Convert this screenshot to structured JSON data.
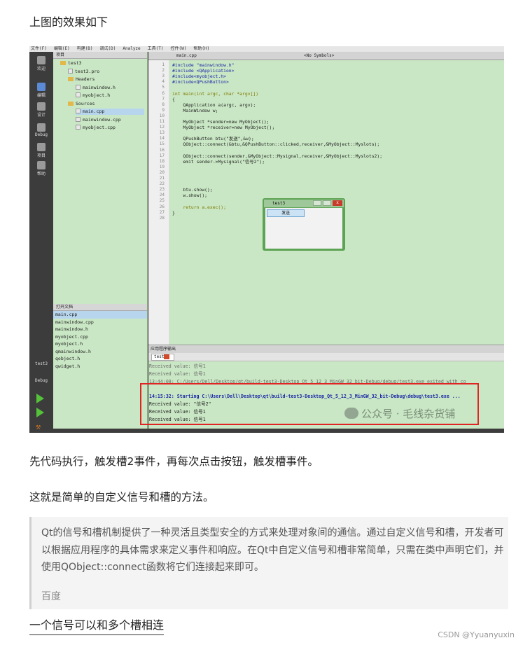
{
  "heading_top": "上图的效果如下",
  "screenshot": {
    "menubar": [
      "文件(F)",
      "编辑(E)",
      "构建(B)",
      "调试(D)",
      "Analyze",
      "工具(T)",
      "控件(W)",
      "帮助(H)"
    ],
    "project_panel_title": "项目",
    "tree": [
      {
        "label": "test3",
        "kind": "folder",
        "indent": 0
      },
      {
        "label": "test3.pro",
        "kind": "file",
        "indent": 1
      },
      {
        "label": "Headers",
        "kind": "folder",
        "indent": 1
      },
      {
        "label": "mainwindow.h",
        "kind": "file",
        "indent": 2
      },
      {
        "label": "myobject.h",
        "kind": "file",
        "indent": 2
      },
      {
        "label": "Sources",
        "kind": "folder",
        "indent": 1
      },
      {
        "label": "main.cpp",
        "kind": "file",
        "indent": 2,
        "selected": true
      },
      {
        "label": "mainwindow.cpp",
        "kind": "file",
        "indent": 2
      },
      {
        "label": "myobject.cpp",
        "kind": "file",
        "indent": 2
      }
    ],
    "modes": [
      "欢迎",
      "编辑",
      "设计",
      "Debug",
      "项目",
      "帮助"
    ],
    "mode_bottom": [
      "test3",
      "Debug"
    ],
    "open_docs_title": "打开文档",
    "open_docs": [
      "main.cpp",
      "mainwindow.cpp",
      "mainwindow.h",
      "myobject.cpp",
      "myobject.h",
      "qmainwindow.h",
      "qobject.h",
      "qwidget.h"
    ],
    "editor_file": "main.cpp",
    "editor_symbols": "<No Symbols>",
    "code_lines": [
      "#include \"mainwindow.h\"",
      "#include <QApplication>",
      "#include<myobject.h>",
      "#include<QPushButton>",
      "",
      "int main(int argc, char *argv[])",
      "{",
      "    QApplication a(argc, argv);",
      "    MainWindow w;",
      "",
      "    MyObject *sender=new MyObject();",
      "    MyObject *receiver=new MyObject();",
      "",
      "    QPushButton btu(\"发送\",&w);",
      "    QObject::connect(&btu,&QPushButton::clicked,receiver,&MyObject::Myslots);",
      "",
      "    QObject::connect(sender,&MyObject::Mysignal,receiver,&MyObject::Myslots2);",
      "    emit sender->Mysignal(\"信号2\");",
      "",
      "",
      "",
      "",
      "    btu.show();",
      "    w.show();",
      "",
      "    return a.exec();",
      "}",
      ""
    ],
    "dialog": {
      "title": "test3",
      "button": "发送",
      "close": "x"
    },
    "output_title": "应用程序输出",
    "output_tab": "test3",
    "output_lines": [
      {
        "text": "Received value: 信号1",
        "style": "gray"
      },
      {
        "text": "Received value: 信号1",
        "style": "gray"
      },
      {
        "text": "13:44:08: C:/Users/Dell/Desktop/qt/build-test3-Desktop_Qt_5_12_3_MinGW_32_bit-Debug/debug/test3.exe exited with co",
        "style": "gray"
      },
      {
        "text": "",
        "style": "gray"
      },
      {
        "text": "14:15:32: Starting C:\\Users\\Dell\\Desktop\\qt\\build-test3-Desktop_Qt_5_12_3_MinGW_32_bit-Debug\\debug\\test3.exe ...",
        "style": "blue"
      },
      {
        "text": "Received value: \"信号2\"",
        "style": "normal"
      },
      {
        "text": "Received value: 信号1",
        "style": "normal"
      },
      {
        "text": "Received value: 信号1",
        "style": "normal"
      }
    ],
    "watermark": "公众号 · 毛线杂货铺"
  },
  "para1": "先代码执行，触发槽2事件，再每次点击按钮，触发槽事件。",
  "para2": "这就是简单的自定义信号和槽的方法。",
  "quote": {
    "text": "Qt的信号和槽机制提供了一种灵活且类型安全的方式来处理对象间的通信。通过自定义信号和槽，开发者可以根据应用程序的具体需求来定义事件和响应。在Qt中自定义信号和槽非常简单，只需在类中声明它们，并使用QObject::connect函数将它们连接起来即可。",
    "source": "百度"
  },
  "heading_bottom": "一个信号可以和多个槽相连",
  "csdn_mark": "CSDN @Yyuanyuxin"
}
